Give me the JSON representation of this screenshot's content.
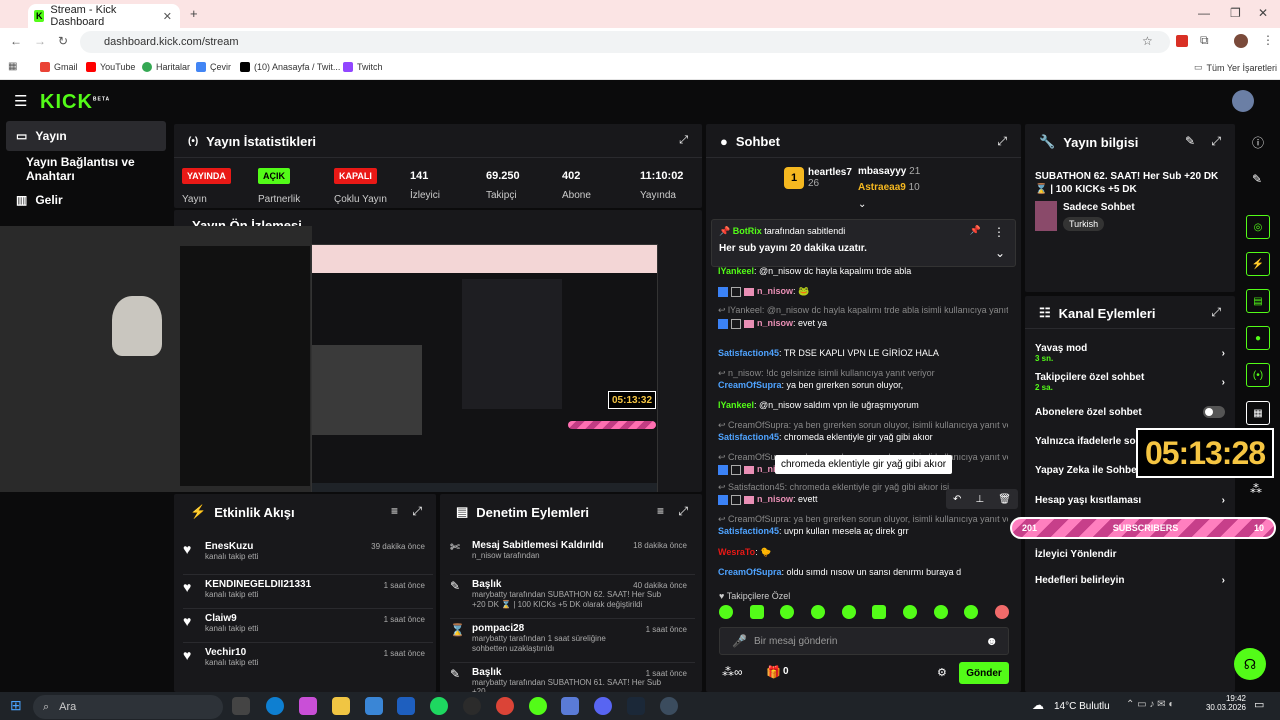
{
  "browser": {
    "tab_title": "Stream - Kick Dashboard",
    "url": "dashboard.kick.com/stream",
    "bookmarks": [
      "Gmail",
      "YouTube",
      "Haritalar",
      "Çevir",
      "(10) Anasayfa / Twit...",
      "Twitch"
    ],
    "all_bookmarks": "Tüm Yer İşaretleri"
  },
  "nav": {
    "logo": "KICK",
    "beta": "BETA",
    "items": [
      "Yayın",
      "Yayın Bağlantısı ve Anahtarı",
      "Gelir"
    ]
  },
  "stats": {
    "title": "Yayın İstatistikleri",
    "cols": [
      {
        "badge": "YAYINDA",
        "label": "Yayın"
      },
      {
        "badge": "AÇIK",
        "label": "Partnerlik"
      },
      {
        "badge": "KAPALI",
        "label": "Çoklu Yayın"
      },
      {
        "value": "141",
        "label": "İzleyici"
      },
      {
        "value": "69.250",
        "label": "Takipçi"
      },
      {
        "value": "402",
        "label": "Abone"
      },
      {
        "value": "11:10:02",
        "label": "Yayında"
      }
    ]
  },
  "preview": {
    "title": "Yayın Ön İzlemesi",
    "timer": "05:13:32"
  },
  "events": {
    "title": "Etkinlik Akışı",
    "items": [
      {
        "name": "EnesKuzu",
        "sub": "kanalı takip etti",
        "time": "39 dakika önce"
      },
      {
        "name": "KENDINEGELDII21331",
        "sub": "kanalı takip etti",
        "time": "1 saat önce"
      },
      {
        "name": "Claiw9",
        "sub": "kanalı takip etti",
        "time": "1 saat önce"
      },
      {
        "name": "Vechir10",
        "sub": "kanalı takip etti",
        "time": "1 saat önce"
      }
    ]
  },
  "moderation": {
    "title": "Denetim Eylemleri",
    "items": [
      {
        "name": "Mesaj Sabitlemesi Kaldırıldı",
        "sub": "n_nisow tarafından",
        "time": "18 dakika önce"
      },
      {
        "name": "Başlık",
        "sub": "marybatty tarafından SUBATHON 62. SAAT! Her Sub +20 DK ⌛ | 100 KICKs +5 DK olarak değiştirildi",
        "time": "40 dakika önce"
      },
      {
        "name": "pompaci28",
        "sub": "marybatty tarafından 1 saat süreliğine sohbetten uzaklaştırıldı",
        "time": "1 saat önce"
      },
      {
        "name": "Başlık",
        "sub": "marybatty tarafından SUBATHON 61. SAAT! Her Sub +20",
        "time": "1 saat önce"
      }
    ]
  },
  "chat": {
    "title": "Sohbet",
    "top": [
      {
        "name": "heartles7",
        "count": "26"
      },
      {
        "name": "mbasayyy",
        "count": "21"
      },
      {
        "name": "Astraeaa9",
        "count": "10"
      }
    ],
    "pinned_by": "BotRix",
    "pinned_suffix": "tarafından sabitlendi",
    "pinned_msg": "Her sub yayını 20 dakika uzatır.",
    "messages": [
      {
        "kind": "plain",
        "user": "lYankeel",
        "text": ": @n_nisow dc hayla kapalımı trde abla"
      },
      {
        "kind": "badge",
        "user": "n_nisow",
        "text": ": 🐸"
      },
      {
        "kind": "reply",
        "text": "↩ lYankeel: @n_nisow dc hayla kapalımı trde abla isimli kullanıcıya yanıt ..."
      },
      {
        "kind": "badge",
        "user": "n_nisow",
        "text": ": evet ya"
      },
      {
        "kind": "plain",
        "user": "Satisfaction45",
        "text": ": TR DSE KAPLI VPN LE GİRİOZ HALA"
      },
      {
        "kind": "reply",
        "text": "↩ n_nisow: !dc gelsinize isimli kullanıcıya yanıt veriyor"
      },
      {
        "kind": "plain",
        "user": "CreamOfSupra",
        "text": ": ya ben gırerken sorun oluyor,"
      },
      {
        "kind": "plain2",
        "user": "lYankeel",
        "text": ": @n_nisow saldım vpn ile uğraşmıyorum"
      },
      {
        "kind": "reply",
        "text": "↩ CreamOfSupra: ya ben gırerken sorun oluyor, isimli kullanıcıya yanıt ve..."
      },
      {
        "kind": "plain",
        "user": "Satisfaction45",
        "text": ": chromeda eklentiyle gir yağ gibi akıor"
      },
      {
        "kind": "reply",
        "text": "↩ CreamOfSupra: ya ben gırerken sorun oluyor, isimli kullanıcıya yanıt ve..."
      },
      {
        "kind": "badge",
        "user": "n_nisow",
        "text": ""
      },
      {
        "kind": "reply",
        "text": "↩ Satisfaction45: chromeda eklentiyle gir yağ gibi akıor isi..."
      },
      {
        "kind": "badge",
        "user": "n_nisow",
        "text": ": evett"
      },
      {
        "kind": "reply",
        "text": "↩ CreamOfSupra: ya ben gırerken sorun oluyor, isimli kullanıcıya yanıt ve..."
      },
      {
        "kind": "plain",
        "user": "Satisfaction45",
        "text": ": uvpn kullan mesela aç direk grr"
      },
      {
        "kind": "red",
        "user": "WesraTo",
        "text": ": 🐤"
      },
      {
        "kind": "plain",
        "user": "CreamOfSupra",
        "text": ": oldu sımdı nısow un sansı denırmı buraya d"
      }
    ],
    "tooltip": "chromeda eklentiyle gir yağ gibi akıor",
    "followers_only": "Takipçilere Özel",
    "input_placeholder": "Bir mesaj gönderin",
    "count": "0",
    "send": "Gönder"
  },
  "info": {
    "title": "Yayın bilgisi",
    "stream_title": "SUBATHON 62. SAAT! Her Sub +20 DK ⌛ | 100 KICKs +5 DK",
    "category": "Sadece Sohbet",
    "tag": "Turkish"
  },
  "actions": {
    "title": "Kanal Eylemleri",
    "items": [
      {
        "label": "Yavaş mod",
        "sub": "3 sn."
      },
      {
        "label": "Takipçilere özel sohbet",
        "sub": "2 sa."
      },
      {
        "label": "Abonelere özel sohbet",
        "sub": ""
      },
      {
        "label": "Yalnızca ifadelerle sohbet",
        "sub": ""
      },
      {
        "label": "Yapay Zeka ile Sohbet",
        "sub": ""
      },
      {
        "label": "Hesap yaşı kısıtlaması",
        "sub": ""
      },
      {
        "label": "",
        "sub": ""
      },
      {
        "label": "İzleyici Yönlendir",
        "sub": ""
      },
      {
        "label": "Hedefleri belirleyin",
        "sub": ""
      }
    ],
    "overlay_timer": "05:13:28",
    "sub_bar": {
      "left": "201",
      "label": "SUBSCRIBERS",
      "right": "10"
    }
  },
  "taskbar": {
    "search": "Ara",
    "weather": "14°C Bulutlu",
    "time": "19:42",
    "date": "30.03.2026"
  },
  "colors": {
    "kick_green": "#53fc18",
    "panel": "#18181b",
    "live_red": "#e91916"
  }
}
